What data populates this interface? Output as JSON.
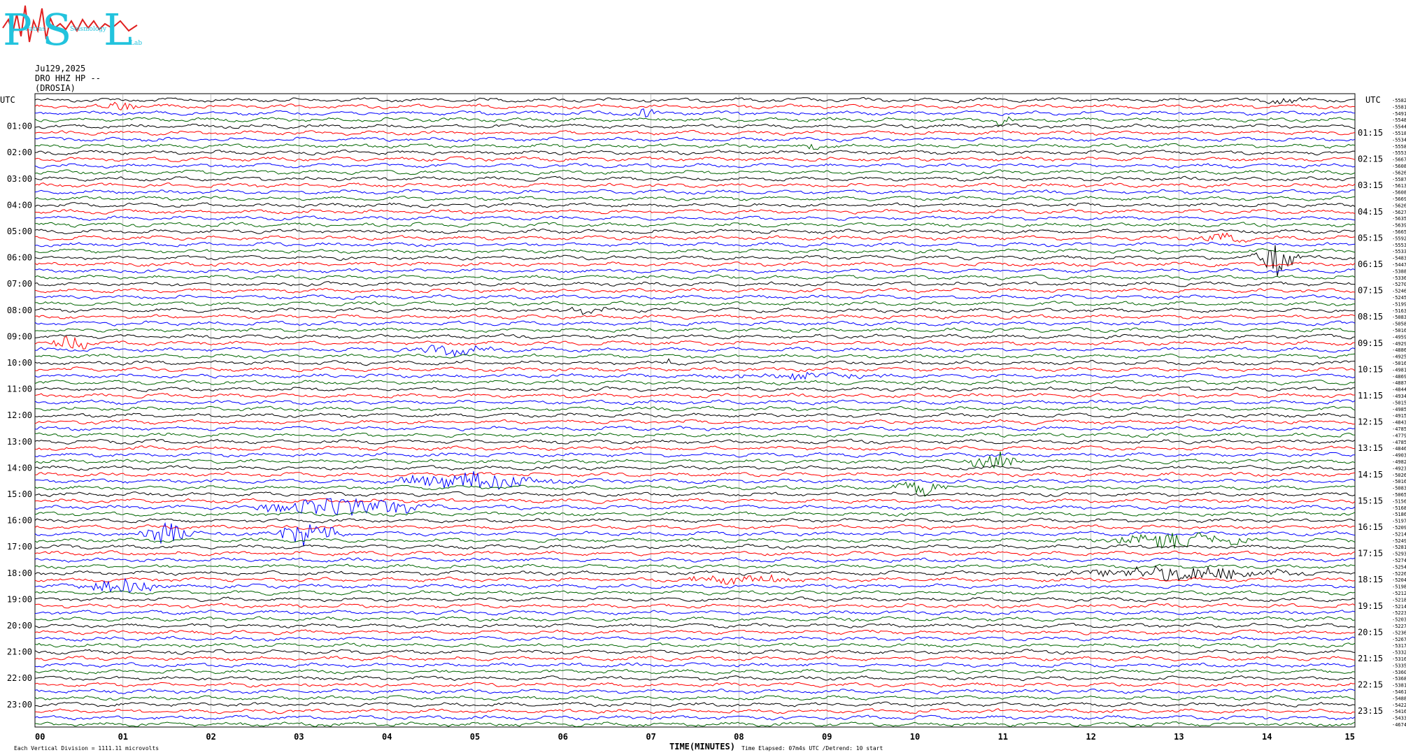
{
  "header": {
    "date": "Ju129,2025",
    "station": "DRO HHZ HP --",
    "location": "(DROSIA)",
    "logo": {
      "letters": [
        "P",
        "S",
        "L"
      ],
      "words": [
        "Patras",
        "Seismology",
        "Lab"
      ]
    }
  },
  "axis": {
    "left_title": "UTC",
    "right_title": "UTC",
    "xlabel": "TIME(MINUTES)",
    "footer_left": "Each Vertical Division = 1111.11 microvolts",
    "footer_right": "Time Elapsed: 07m4s UTC /Detrend: 10 start"
  },
  "colors": {
    "trace_cycle": [
      "#000000",
      "#ff0000",
      "#0000ff",
      "#006400"
    ],
    "logo_cyan": "#22c3dd",
    "logo_red": "#e02020",
    "grid": "#9a9a9a"
  },
  "chart_data": {
    "type": "line",
    "title": "",
    "xlabel": "TIME(MINUTES)",
    "ylabel": "UTC",
    "xlim": [
      0,
      15
    ],
    "x_ticks": [
      "00",
      "01",
      "02",
      "03",
      "04",
      "05",
      "06",
      "07",
      "08",
      "09",
      "10",
      "11",
      "12",
      "13",
      "14",
      "15"
    ],
    "lines_per_hour": 4,
    "hours": 24,
    "left_tick_labels": [
      "01:00",
      "02:00",
      "03:00",
      "04:00",
      "05:00",
      "06:00",
      "07:00",
      "08:00",
      "09:00",
      "10:00",
      "11:00",
      "12:00",
      "13:00",
      "14:00",
      "15:00",
      "16:00",
      "17:00",
      "18:00",
      "19:00",
      "20:00",
      "21:00",
      "22:00",
      "23:00"
    ],
    "right_tick_labels": [
      "01:15",
      "02:15",
      "03:15",
      "04:15",
      "05:15",
      "06:15",
      "07:15",
      "08:15",
      "09:15",
      "10:15",
      "11:15",
      "12:15",
      "13:15",
      "14:15",
      "15:15",
      "16:15",
      "17:15",
      "18:15",
      "19:15",
      "20:15",
      "21:15",
      "22:15",
      "23:15"
    ],
    "line_offsets": [
      "-5582",
      "-5581",
      "-5491",
      "-5548",
      "-5544",
      "-5518",
      "-5534",
      "-5558",
      "-5553",
      "-5667",
      "-5608",
      "-5626",
      "-5587",
      "-5613",
      "-5608",
      "-5669",
      "-5626",
      "-5627",
      "-5635",
      "-5639",
      "-5665",
      "-5592",
      "-5553",
      "-5533",
      "-5483",
      "-5447",
      "-5388",
      "-5336",
      "-5270",
      "-5246",
      "-5245",
      "-5199",
      "-5163",
      "-5083",
      "-5058",
      "-5016",
      "-4959",
      "-4929",
      "-4886",
      "-4925",
      "-5016",
      "-4981",
      "-4869",
      "-4887",
      "-4844",
      "-4934",
      "-5015",
      "-4985",
      "-4915",
      "-4843",
      "-4785",
      "-4779",
      "-4785",
      "-4846",
      "-4903",
      "-4982",
      "-4923",
      "-5026",
      "-5016",
      "-5083",
      "-5065",
      "-5156",
      "-5168",
      "-5186",
      "-5197",
      "-5209",
      "-5214",
      "-5249",
      "-5281",
      "-5293",
      "-5274",
      "-5254",
      "-5226",
      "-5204",
      "-5198",
      "-5212",
      "-5218",
      "-5214",
      "-5223",
      "-5203",
      "-5227",
      "-5236",
      "-5267",
      "-5317",
      "-5332",
      "-5316",
      "-5335",
      "-5360",
      "-5368",
      "-5381",
      "-5461",
      "-5488",
      "-5422",
      "-5416",
      "-5433",
      "-4674"
    ],
    "events": [
      {
        "line": 0,
        "minute": 14.2,
        "amp": 0.5,
        "width": 0.3
      },
      {
        "line": 1,
        "minute": 1.0,
        "amp": 0.7,
        "width": 0.3
      },
      {
        "line": 2,
        "minute": 6.9,
        "amp": 0.6,
        "width": 0.2
      },
      {
        "line": 3,
        "minute": 11.0,
        "amp": 0.6,
        "width": 0.2
      },
      {
        "line": 7,
        "minute": 8.8,
        "amp": 0.5,
        "width": 0.2
      },
      {
        "line": 21,
        "minute": 13.5,
        "amp": 0.5,
        "width": 0.6
      },
      {
        "line": 24,
        "minute": 14.1,
        "amp": 2.2,
        "width": 0.3
      },
      {
        "line": 32,
        "minute": 6.2,
        "amp": 0.5,
        "width": 0.4
      },
      {
        "line": 37,
        "minute": 0.4,
        "amp": 0.9,
        "width": 0.3
      },
      {
        "line": 38,
        "minute": 4.7,
        "amp": 0.6,
        "width": 0.6
      },
      {
        "line": 40,
        "minute": 7.2,
        "amp": 0.5,
        "width": 0.1
      },
      {
        "line": 42,
        "minute": 8.8,
        "amp": 0.4,
        "width": 1.6
      },
      {
        "line": 55,
        "minute": 10.9,
        "amp": 1.2,
        "width": 0.4
      },
      {
        "line": 58,
        "minute": 5.0,
        "amp": 1.1,
        "width": 1.2
      },
      {
        "line": 59,
        "minute": 10.1,
        "amp": 1.0,
        "width": 0.4
      },
      {
        "line": 62,
        "minute": 3.5,
        "amp": 1.3,
        "width": 1.2
      },
      {
        "line": 66,
        "minute": 1.5,
        "amp": 1.5,
        "width": 0.4
      },
      {
        "line": 66,
        "minute": 3.1,
        "amp": 1.6,
        "width": 0.5
      },
      {
        "line": 67,
        "minute": 13.0,
        "amp": 1.0,
        "width": 1.0
      },
      {
        "line": 72,
        "minute": 13.0,
        "amp": 0.9,
        "width": 1.6
      },
      {
        "line": 73,
        "minute": 8.0,
        "amp": 0.6,
        "width": 0.8
      },
      {
        "line": 74,
        "minute": 1.0,
        "amp": 1.0,
        "width": 0.6
      }
    ]
  }
}
